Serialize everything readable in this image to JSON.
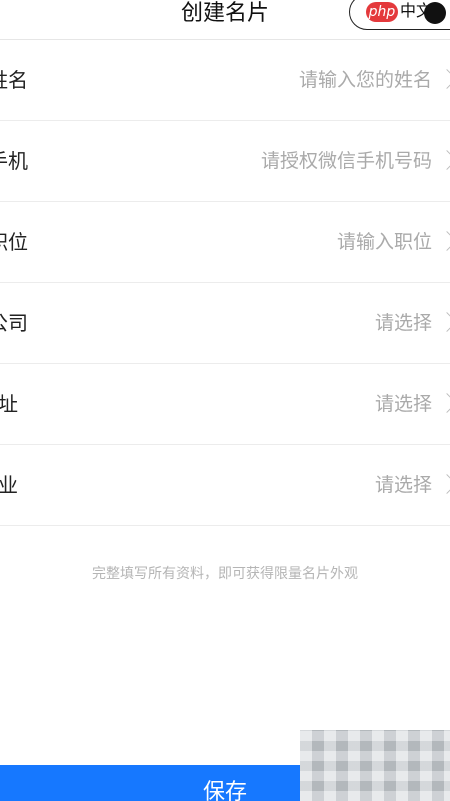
{
  "header": {
    "title": "创建名片",
    "badge": {
      "logo": "php",
      "site": "中文"
    }
  },
  "form": {
    "rows": [
      {
        "label": "*姓名",
        "value": "请输入您的姓名"
      },
      {
        "label": "*手机",
        "value": "请授权微信手机号码"
      },
      {
        "label": "*职位",
        "value": "请输入职位"
      },
      {
        "label": "*公司",
        "value": "请选择"
      },
      {
        "label": "地址",
        "value": "请选择"
      },
      {
        "label": "行业",
        "value": "请选择"
      }
    ]
  },
  "hint": "完整填写所有资料，即可获得限量名片外观",
  "footer": {
    "save_label": "保存"
  },
  "colors": {
    "primary": "#1678ff",
    "placeholder": "#aaaaaa"
  }
}
